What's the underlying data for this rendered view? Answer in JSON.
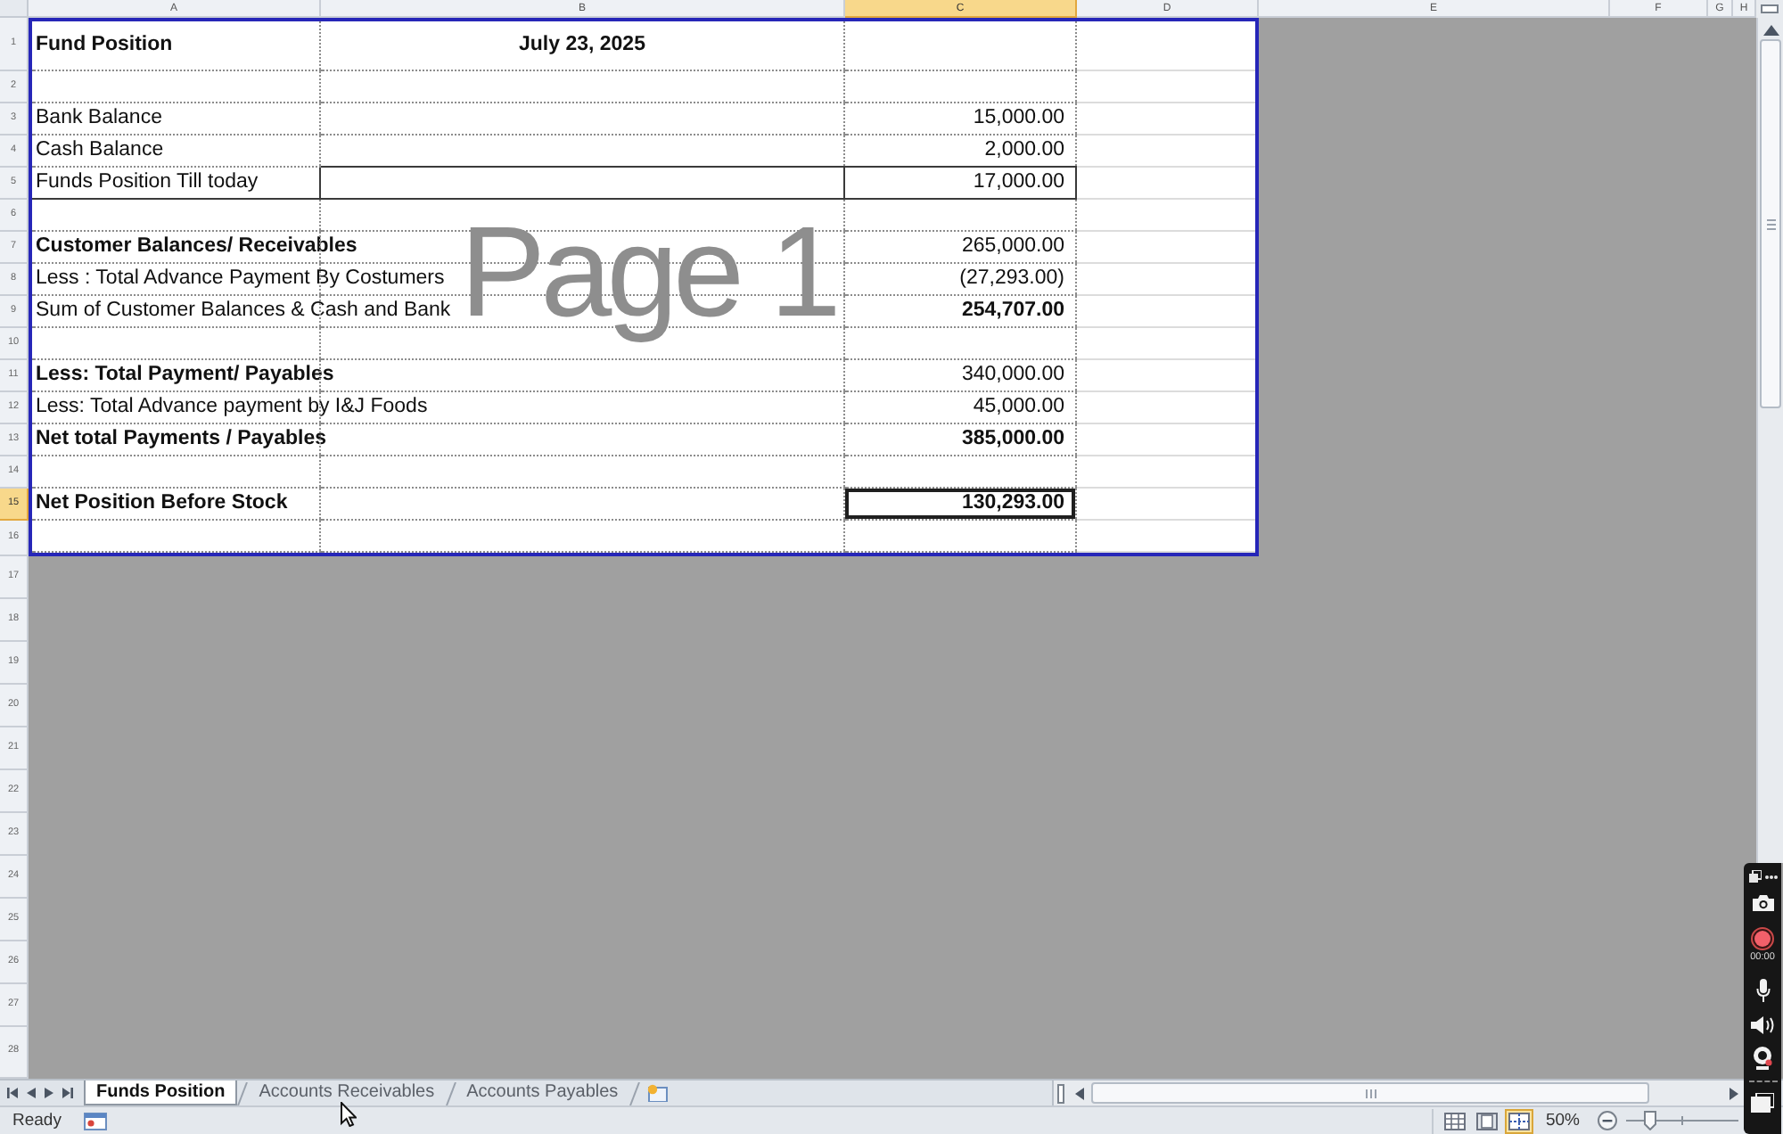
{
  "column_headers": [
    {
      "label": "A",
      "selected": false
    },
    {
      "label": "B",
      "selected": false
    },
    {
      "label": "C",
      "selected": true
    },
    {
      "label": "D",
      "selected": false
    },
    {
      "label": "E",
      "selected": false
    },
    {
      "label": "F",
      "selected": false
    },
    {
      "label": "G",
      "selected": false
    },
    {
      "label": "H",
      "selected": false
    }
  ],
  "print_area": {
    "page_label": "Page 1",
    "rows": [
      {
        "number": "1",
        "selected": false,
        "boxed": false,
        "cells": {
          "A": {
            "text": "Fund Position",
            "bold": true,
            "selected": false
          },
          "B": {
            "text": "July 23, 2025",
            "bold": true,
            "selected": false
          }
        }
      },
      {
        "number": "2",
        "selected": false,
        "boxed": false
      },
      {
        "number": "3",
        "selected": false,
        "boxed": false,
        "cells": {
          "A": {
            "text": "Bank Balance",
            "bold": false,
            "selected": false
          },
          "C": {
            "text": "15,000.00",
            "bold": false,
            "selected": false
          }
        }
      },
      {
        "number": "4",
        "selected": false,
        "boxed": false,
        "cells": {
          "A": {
            "text": "Cash Balance",
            "bold": false,
            "selected": false
          },
          "C": {
            "text": "2,000.00",
            "bold": false,
            "selected": false
          }
        }
      },
      {
        "number": "5",
        "selected": false,
        "boxed": true,
        "cells": {
          "A": {
            "text": "Funds Position Till today",
            "bold": false,
            "selected": false
          },
          "C": {
            "text": "17,000.00",
            "bold": false,
            "selected": false
          }
        }
      },
      {
        "number": "6",
        "selected": false,
        "boxed": false
      },
      {
        "number": "7",
        "selected": false,
        "boxed": false,
        "cells": {
          "A": {
            "text": "Customer Balances/ Receivables",
            "bold": true,
            "selected": false
          },
          "C": {
            "text": "265,000.00",
            "bold": false,
            "selected": false
          }
        }
      },
      {
        "number": "8",
        "selected": false,
        "boxed": false,
        "cells": {
          "A": {
            "text": "Less : Total Advance Payment By Costumers",
            "bold": false,
            "selected": false
          },
          "C": {
            "text": "(27,293.00)",
            "bold": false,
            "selected": false
          }
        }
      },
      {
        "number": "9",
        "selected": false,
        "boxed": false,
        "cells": {
          "A": {
            "text": "Sum of Customer Balances & Cash and Bank",
            "bold": false,
            "selected": false
          },
          "C": {
            "text": "254,707.00",
            "bold": true,
            "selected": false
          }
        }
      },
      {
        "number": "10",
        "selected": false,
        "boxed": false
      },
      {
        "number": "11",
        "selected": false,
        "boxed": false,
        "cells": {
          "A": {
            "text": "Less: Total Payment/ Payables",
            "bold": true,
            "selected": false
          },
          "C": {
            "text": "340,000.00",
            "bold": false,
            "selected": false
          }
        }
      },
      {
        "number": "12",
        "selected": false,
        "boxed": false,
        "cells": {
          "A": {
            "text": "Less: Total Advance payment by I&J Foods",
            "bold": false,
            "selected": false
          },
          "C": {
            "text": "45,000.00",
            "bold": false,
            "selected": false
          }
        }
      },
      {
        "number": "13",
        "selected": false,
        "boxed": false,
        "cells": {
          "A": {
            "text": "Net total Payments / Payables",
            "bold": true,
            "selected": false
          },
          "C": {
            "text": "385,000.00",
            "bold": true,
            "selected": false
          }
        }
      },
      {
        "number": "14",
        "selected": false,
        "boxed": false
      },
      {
        "number": "15",
        "selected": true,
        "boxed": false,
        "cells": {
          "A": {
            "text": "Net Position Before Stock",
            "bold": true,
            "selected": false
          },
          "C": {
            "text": "130,293.00",
            "bold": true,
            "selected": true
          }
        }
      },
      {
        "number": "16",
        "selected": false,
        "boxed": false
      }
    ]
  },
  "rows_below": [
    {
      "number": "17",
      "selected": false
    },
    {
      "number": "18",
      "selected": false
    },
    {
      "number": "19",
      "selected": false
    },
    {
      "number": "20",
      "selected": false
    },
    {
      "number": "21",
      "selected": false
    },
    {
      "number": "22",
      "selected": false
    },
    {
      "number": "23",
      "selected": false
    },
    {
      "number": "24",
      "selected": false
    },
    {
      "number": "25",
      "selected": false
    },
    {
      "number": "26",
      "selected": false
    },
    {
      "number": "27",
      "selected": false
    },
    {
      "number": "28",
      "selected": false
    }
  ],
  "sheet_tabs": [
    {
      "label": "Funds Position",
      "selected": true
    },
    {
      "label": "Accounts Receivables",
      "selected": false
    },
    {
      "label": "Accounts Payables",
      "selected": false
    }
  ],
  "status_bar": {
    "status": "Ready",
    "view_buttons": [
      {
        "kind": "normal",
        "selected": false
      },
      {
        "kind": "page_layout",
        "selected": false
      },
      {
        "kind": "page_break_preview",
        "selected": true
      }
    ],
    "zoom": "50%",
    "zoom_slider": {
      "level": 0.22
    }
  },
  "recorder_toolbar": {
    "timer": "00:00"
  }
}
